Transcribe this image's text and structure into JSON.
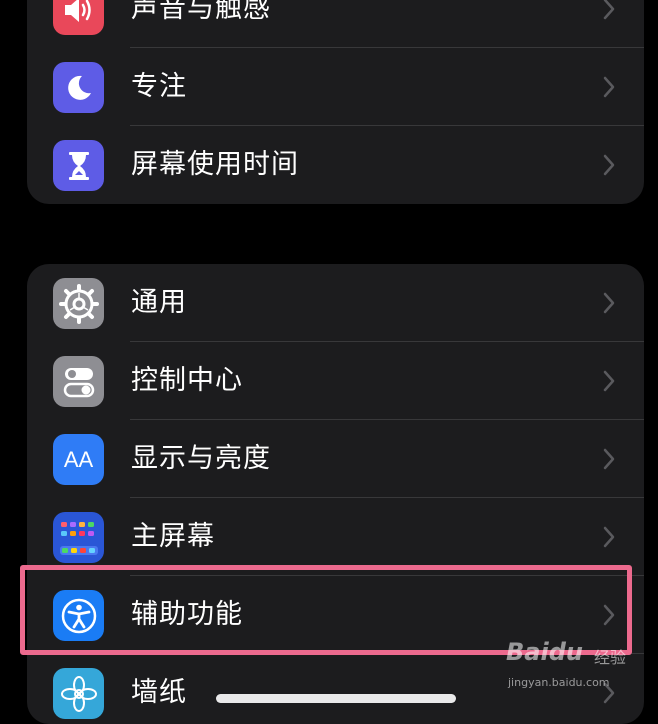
{
  "group_top": {
    "items": [
      {
        "label": "声音与触感",
        "icon": "speaker-icon",
        "color": "#e9485a"
      },
      {
        "label": "专注",
        "icon": "moon-icon",
        "color": "#5e5ce6"
      },
      {
        "label": "屏幕使用时间",
        "icon": "hourglass-icon",
        "color": "#5e5ce6"
      }
    ]
  },
  "group_main": {
    "items": [
      {
        "label": "通用",
        "icon": "gear-icon",
        "color": "#8e8e93"
      },
      {
        "label": "控制中心",
        "icon": "toggles-icon",
        "color": "#8e8e93"
      },
      {
        "label": "显示与亮度",
        "icon": "text-size-icon",
        "color": "#2f7cf6",
        "icon_text": "AA"
      },
      {
        "label": "主屏幕",
        "icon": "home-grid-icon",
        "color": "#2a56d6"
      },
      {
        "label": "辅助功能",
        "icon": "accessibility-icon",
        "color": "#1a7cf5"
      },
      {
        "label": "墙纸",
        "icon": "flower-icon",
        "color": "#35a7d9"
      }
    ]
  },
  "watermark": {
    "brand": "Baidu",
    "cn": "经验",
    "url": "jingyan.baidu.com"
  }
}
